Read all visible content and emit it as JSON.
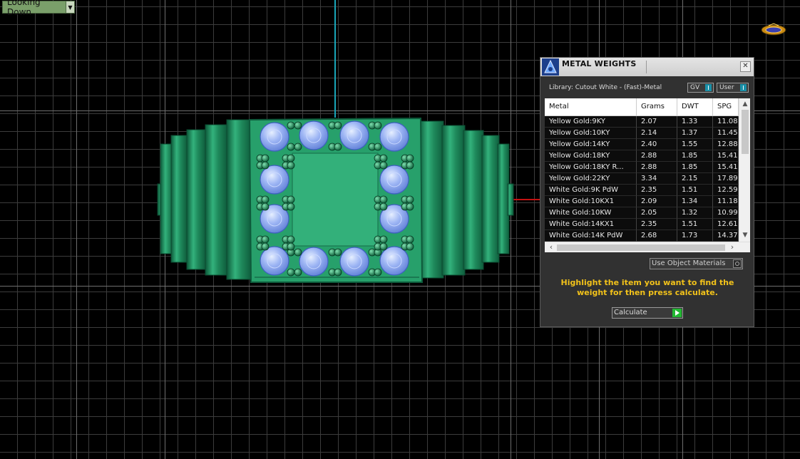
{
  "viewport": {
    "view_mode": "Looking Down",
    "colors": {
      "background": "#000000",
      "grid": "#3c3c3c",
      "ring_metal": "#2aa872",
      "stones": "#8fa8f0",
      "y_axis": "#19a6b8",
      "x_axis": "#c41212"
    }
  },
  "panel": {
    "title": "METAL WEIGHTS",
    "library": "Library: Cutout White - (Fast)-Metal",
    "toggles": {
      "gv": "GV",
      "user": "User"
    },
    "table": {
      "headers": [
        "Metal",
        "Grams",
        "DWT",
        "SPG"
      ],
      "rows": [
        [
          "Yellow Gold:9KY",
          "2.07",
          "1.33",
          "11.08"
        ],
        [
          "Yellow Gold:10KY",
          "2.14",
          "1.37",
          "11.45"
        ],
        [
          "Yellow Gold:14KY",
          "2.40",
          "1.55",
          "12.88"
        ],
        [
          "Yellow Gold:18KY",
          "2.88",
          "1.85",
          "15.41"
        ],
        [
          "Yellow Gold:18KY R...",
          "2.88",
          "1.85",
          "15.41"
        ],
        [
          "Yellow Gold:22KY",
          "3.34",
          "2.15",
          "17.89"
        ],
        [
          "White Gold:9K PdW",
          "2.35",
          "1.51",
          "12.59"
        ],
        [
          "White Gold:10KX1",
          "2.09",
          "1.34",
          "11.18"
        ],
        [
          "White Gold:10KW",
          "2.05",
          "1.32",
          "10.99"
        ],
        [
          "White Gold:14KX1",
          "2.35",
          "1.51",
          "12.61"
        ],
        [
          "White Gold:14K PdW",
          "2.68",
          "1.73",
          "14.37"
        ]
      ]
    },
    "use_object_materials": "Use Object Materials",
    "hint": "Highlight the item you want to find the weight for then press calculate.",
    "calculate_label": "Calculate",
    "accent_hint_color": "#f2c21a",
    "accent_go_color": "#22b832"
  }
}
